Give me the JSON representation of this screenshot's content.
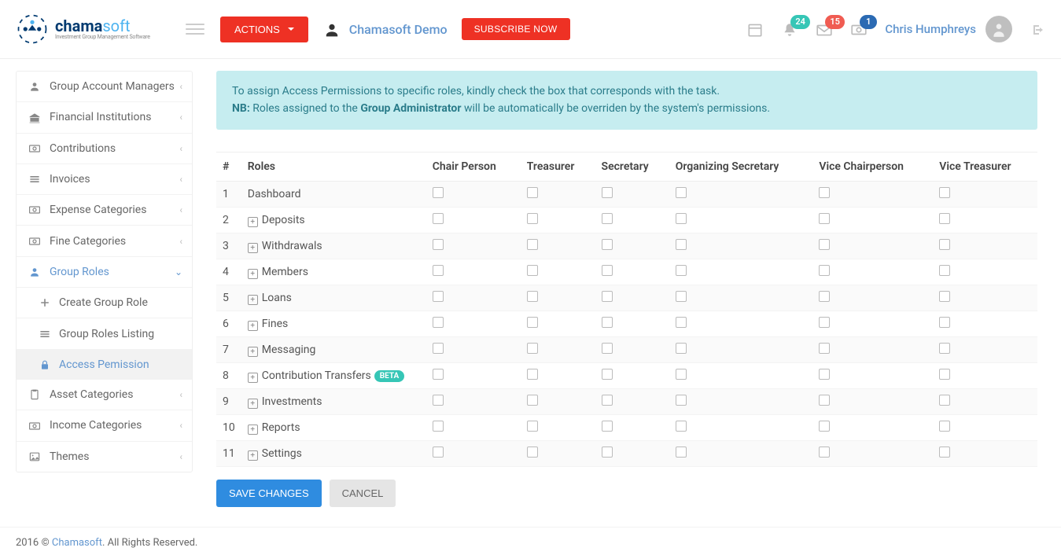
{
  "brand": {
    "name1": "chama",
    "name2": "soft",
    "tagline": "Investment Group Management Software"
  },
  "header": {
    "actions_label": "ACTIONS",
    "group_name": "Chamasoft Demo",
    "subscribe_label": "SUBSCRIBE NOW",
    "badge_notifications": "24",
    "badge_messages": "15",
    "badge_money": "1",
    "user_name": "Chris Humphreys"
  },
  "sidebar": {
    "items": [
      {
        "label": "Group Account Managers",
        "icon": "users"
      },
      {
        "label": "Financial Institutions",
        "icon": "bank"
      },
      {
        "label": "Contributions",
        "icon": "money"
      },
      {
        "label": "Invoices",
        "icon": "list"
      },
      {
        "label": "Expense Categories",
        "icon": "money"
      },
      {
        "label": "Fine Categories",
        "icon": "money"
      },
      {
        "label": "Group Roles",
        "icon": "users",
        "active": true
      },
      {
        "label": "Asset Categories",
        "icon": "clipboard"
      },
      {
        "label": "Income Categories",
        "icon": "money"
      },
      {
        "label": "Themes",
        "icon": "image"
      }
    ],
    "sub_items": [
      {
        "label": "Create Group Role",
        "icon": "plus"
      },
      {
        "label": "Group Roles Listing",
        "icon": "list"
      },
      {
        "label": "Access Pemission",
        "icon": "lock",
        "current": true
      }
    ]
  },
  "alert": {
    "line1": "To assign Access Permissions to specific roles, kindly check the box that corresponds with the task.",
    "nb_label": "NB:",
    "nb_pre": " Roles assigned to the ",
    "nb_bold": "Group Administrator",
    "nb_post": " will be automatically be overriden by the system's permissions."
  },
  "table": {
    "headers": [
      "#",
      "Roles",
      "Chair Person",
      "Treasurer",
      "Secretary",
      "Organizing Secretary",
      "Vice Chairperson",
      "Vice Treasurer"
    ],
    "rows": [
      {
        "n": "1",
        "label": "Dashboard",
        "expandable": false,
        "beta": false
      },
      {
        "n": "2",
        "label": "Deposits",
        "expandable": true,
        "beta": false
      },
      {
        "n": "3",
        "label": "Withdrawals",
        "expandable": true,
        "beta": false
      },
      {
        "n": "4",
        "label": "Members",
        "expandable": true,
        "beta": false
      },
      {
        "n": "5",
        "label": "Loans",
        "expandable": true,
        "beta": false
      },
      {
        "n": "6",
        "label": "Fines",
        "expandable": true,
        "beta": false
      },
      {
        "n": "7",
        "label": "Messaging",
        "expandable": true,
        "beta": false
      },
      {
        "n": "8",
        "label": "Contribution Transfers",
        "expandable": true,
        "beta": true
      },
      {
        "n": "9",
        "label": "Investments",
        "expandable": true,
        "beta": false
      },
      {
        "n": "10",
        "label": "Reports",
        "expandable": true,
        "beta": false
      },
      {
        "n": "11",
        "label": "Settings",
        "expandable": true,
        "beta": false
      }
    ],
    "beta_label": "BETA"
  },
  "buttons": {
    "save": "SAVE CHANGES",
    "cancel": "CANCEL"
  },
  "footer": {
    "year": "2016 © ",
    "brand": "Chamasoft",
    "rest": ". All Rights Reserved."
  }
}
